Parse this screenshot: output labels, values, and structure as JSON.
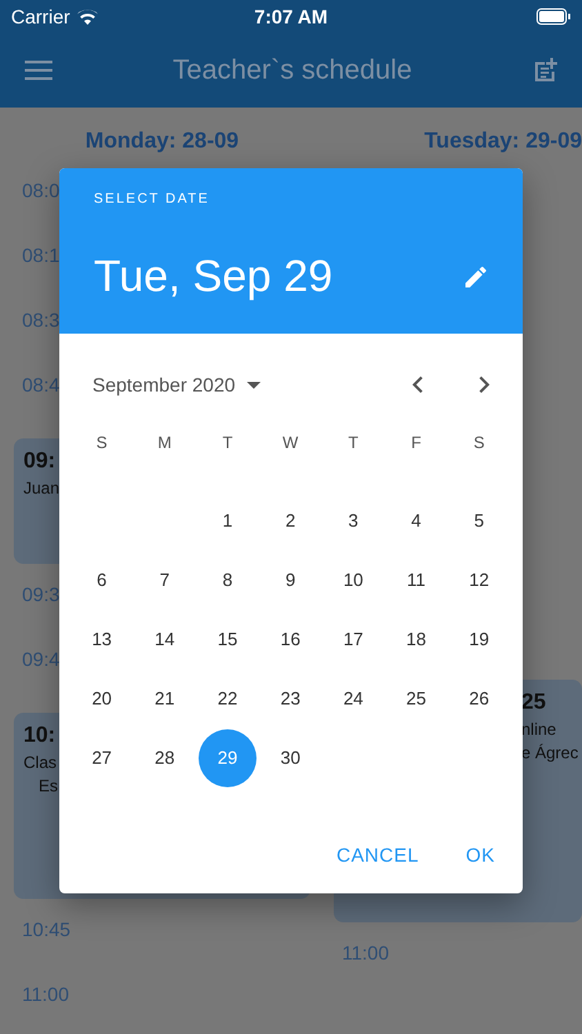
{
  "status_bar": {
    "carrier": "Carrier",
    "time": "7:07 AM"
  },
  "app_bar": {
    "title": "Teacher`s schedule"
  },
  "schedule": {
    "columns": [
      {
        "day": "Monday: 28-09",
        "entries": [
          {
            "kind": "time",
            "text": "08:0"
          },
          {
            "kind": "time",
            "text": "08:1"
          },
          {
            "kind": "time",
            "text": "08:3"
          },
          {
            "kind": "time",
            "text": "08:4"
          },
          {
            "kind": "event",
            "lines": [
              "09:",
              "Juan"
            ]
          },
          {
            "kind": "time",
            "text": "09:3"
          },
          {
            "kind": "time",
            "text": "09:4"
          },
          {
            "kind": "event",
            "lines": [
              "10:",
              "Clas",
              "Es"
            ]
          },
          {
            "kind": "time",
            "text": "10:45"
          },
          {
            "kind": "time",
            "text": "11:00"
          }
        ]
      },
      {
        "day": "Tuesday: 29-09",
        "entries": [
          {
            "kind": "event",
            "lines": [
              "25",
              "nline",
              "e Ágrec"
            ]
          },
          {
            "kind": "time",
            "text": "11:00"
          }
        ]
      }
    ]
  },
  "dialog": {
    "caption": "SELECT DATE",
    "date": "Tue, Sep 29",
    "month": "September 2020",
    "weekdays": [
      "S",
      "M",
      "T",
      "W",
      "T",
      "F",
      "S"
    ],
    "weeks": [
      [
        {
          "day": "1",
          "selected": false
        },
        {
          "day": "2",
          "selected": false
        },
        {
          "day": "3",
          "selected": false
        },
        {
          "day": "4",
          "selected": false
        },
        {
          "day": "5",
          "selected": false
        }
      ],
      [
        {
          "day": "6",
          "selected": false
        },
        {
          "day": "7",
          "selected": false
        },
        {
          "day": "8",
          "selected": false
        },
        {
          "day": "9",
          "selected": false
        },
        {
          "day": "10",
          "selected": false
        },
        {
          "day": "11",
          "selected": false
        },
        {
          "day": "12",
          "selected": false
        }
      ],
      [
        {
          "day": "13",
          "selected": false
        },
        {
          "day": "14",
          "selected": false
        },
        {
          "day": "15",
          "selected": false
        },
        {
          "day": "16",
          "selected": false
        },
        {
          "day": "17",
          "selected": false
        },
        {
          "day": "18",
          "selected": false
        },
        {
          "day": "19",
          "selected": false
        }
      ],
      [
        {
          "day": "20",
          "selected": false
        },
        {
          "day": "21",
          "selected": false
        },
        {
          "day": "22",
          "selected": false
        },
        {
          "day": "23",
          "selected": false
        },
        {
          "day": "24",
          "selected": false
        },
        {
          "day": "25",
          "selected": false
        },
        {
          "day": "26",
          "selected": false
        }
      ],
      [
        {
          "day": "27",
          "selected": false
        },
        {
          "day": "28",
          "selected": false
        },
        {
          "day": "29",
          "selected": true
        },
        {
          "day": "30",
          "selected": false
        }
      ]
    ],
    "buttons": [
      "CANCEL",
      "OK"
    ]
  }
}
